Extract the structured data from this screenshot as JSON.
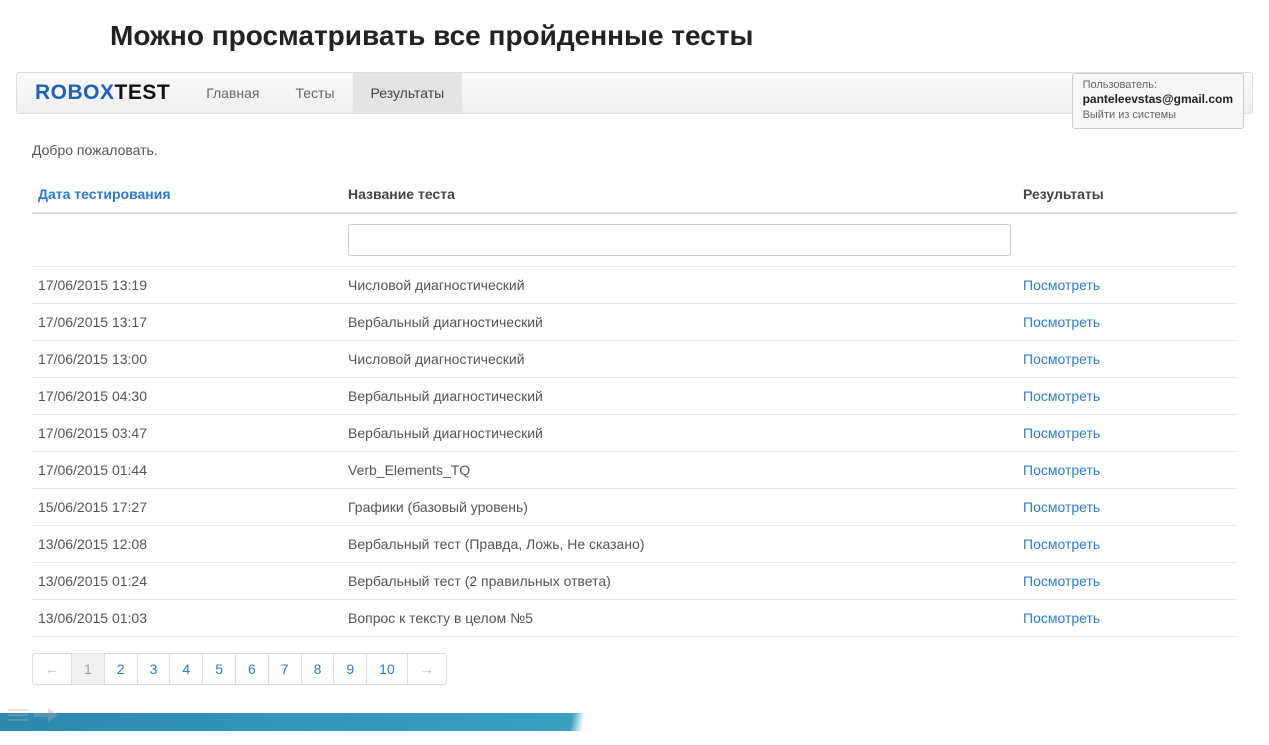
{
  "heading": "Можно просматривать все пройденные тесты",
  "logo": {
    "part1": "ROBOX",
    "part2": "TEST"
  },
  "nav": {
    "items": [
      {
        "label": "Главная",
        "active": false
      },
      {
        "label": "Тесты",
        "active": false
      },
      {
        "label": "Результаты",
        "active": true
      }
    ]
  },
  "user": {
    "label": "Пользователь:",
    "email": "panteleevstas@gmail.com",
    "logout": "Выйти из системы"
  },
  "welcome": "Добро пожаловать.",
  "table": {
    "headers": {
      "date": "Дата тестирования",
      "name": "Название теста",
      "results": "Результаты"
    },
    "filter_value": "",
    "view_label": "Посмотреть",
    "rows": [
      {
        "date": "17/06/2015 13:19",
        "name": "Числовой диагностический"
      },
      {
        "date": "17/06/2015 13:17",
        "name": "Вербальный диагностический"
      },
      {
        "date": "17/06/2015 13:00",
        "name": "Числовой диагностический"
      },
      {
        "date": "17/06/2015 04:30",
        "name": "Вербальный диагностический"
      },
      {
        "date": "17/06/2015 03:47",
        "name": "Вербальный диагностический"
      },
      {
        "date": "17/06/2015 01:44",
        "name": "Verb_Elements_TQ"
      },
      {
        "date": "15/06/2015 17:27",
        "name": "Графики (базовый уровень)"
      },
      {
        "date": "13/06/2015 12:08",
        "name": "Вербальный тест (Правда, Ложь, Не сказано)"
      },
      {
        "date": "13/06/2015 01:24",
        "name": "Вербальный тест (2 правильных ответа)"
      },
      {
        "date": "13/06/2015 01:03",
        "name": "Вопрос к тексту в целом №5"
      }
    ]
  },
  "pagination": {
    "prev": "←",
    "next": "→",
    "pages": [
      "1",
      "2",
      "3",
      "4",
      "5",
      "6",
      "7",
      "8",
      "9",
      "10"
    ],
    "active_index": 0
  }
}
